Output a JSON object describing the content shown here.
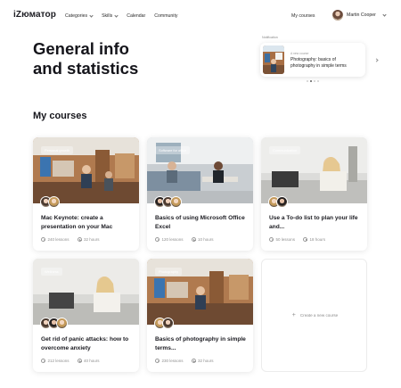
{
  "header": {
    "logo": "iZюматор",
    "menu": [
      {
        "label": "Categories",
        "has_dropdown": true
      },
      {
        "label": "Skills",
        "has_dropdown": true
      },
      {
        "label": "Calendar",
        "has_dropdown": false
      },
      {
        "label": "Community",
        "has_dropdown": false
      }
    ],
    "my_courses": "My courses",
    "user_name": "Martin Cooper"
  },
  "page": {
    "title_line1": "General info",
    "title_line2": "and statistics",
    "section_title": "My courses"
  },
  "notification": {
    "label": "Notification",
    "subtitle": "A new course",
    "text": "Photography: basics of photography in simple terms",
    "dots_count": 4,
    "active_dot": 1
  },
  "courses": [
    {
      "tag": "Personal growth",
      "title": "Mac Keynote: create a presentation on your Mac",
      "lessons": "240 lessons",
      "hours": "32 hours"
    },
    {
      "tag": "Software for office",
      "title": "Basics of using Microsoft Office Excel",
      "lessons": "120 lessons",
      "hours": "10 hours"
    },
    {
      "tag": "Communication",
      "title": "Use a To-do list to plan your life and...",
      "lessons": "50 lessons",
      "hours": "18 hours"
    },
    {
      "tag": "Wellness",
      "title": "Get rid of panic attacks: how to overcome anxiety",
      "lessons": "212 lessons",
      "hours": "40 hours"
    },
    {
      "tag": "Photography",
      "title": "Basics of photography in simple terms...",
      "lessons": "230 lessons",
      "hours": "32 hours"
    }
  ],
  "create_course": {
    "icon": "plus-icon",
    "label": "Create a new course"
  },
  "colors": {
    "text": "#1c1c22",
    "muted": "#8f8f8f",
    "card_shadow": "#e6e6e6",
    "active_dot": "#5a5a5a"
  }
}
